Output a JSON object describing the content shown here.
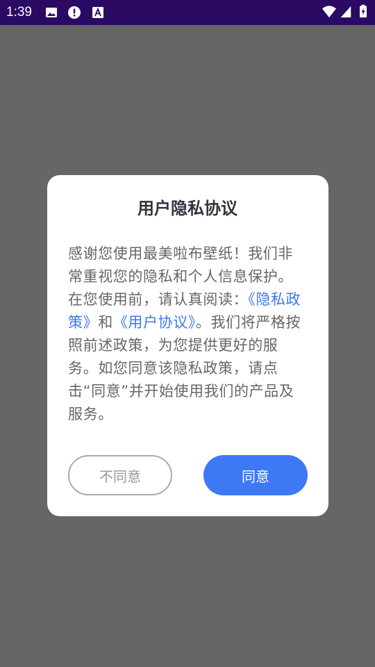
{
  "status_bar": {
    "time": "1:39",
    "left_icons": [
      "image-icon",
      "alert-icon",
      "font-icon"
    ],
    "right_icons": [
      "wifi-icon",
      "signal-icon",
      "battery-charging-icon"
    ]
  },
  "dialog": {
    "title": "用户隐私协议",
    "body": {
      "part1": "感谢您使用最美啦布壁纸！我们非常重视您的隐私和个人信息保护。在您使用前，请认真阅读：",
      "privacy_link": "《隐私政策》",
      "and": "和",
      "agreement_link": "《用户协议》",
      "part2": "。我们将严格按照前述政策，为您提供更好的服务。如您同意该隐私政策，请点击“同意”并开始使用我们的产品及服务。"
    },
    "buttons": {
      "disagree": "不同意",
      "agree": "同意"
    }
  },
  "colors": {
    "status_bar": "#2b0a63",
    "overlay": "#666666",
    "link": "#3b78ee",
    "primary_button": "#3d78f5"
  }
}
